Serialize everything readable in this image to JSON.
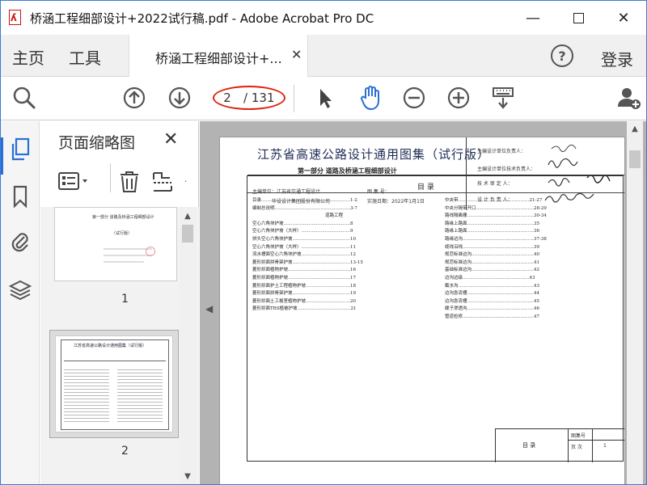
{
  "window": {
    "title": "桥涵工程细部设计+2022试行稿.pdf - Adobe Acrobat Pro DC",
    "min": "—",
    "max": "☐",
    "close": "✕"
  },
  "tabs": {
    "home": "主页",
    "tools": "工具",
    "doc_tab": "桥涵工程细部设计+...",
    "doc_close": "✕",
    "help": "?",
    "login": "登录"
  },
  "toolbar": {
    "page_current": "2",
    "page_total": "/ 131"
  },
  "thumbnails": {
    "title": "页面缩略图",
    "close": "✕",
    "pages": [
      {
        "label": "1",
        "heading": "第一部分   道路及桥涵工程细部设计",
        "sub": "（试行版）"
      },
      {
        "label": "2",
        "heading": "江苏省高速公路设计通用图集（试行版）"
      }
    ]
  },
  "document": {
    "title": "江苏省高速公路设计通用图集（试行版）",
    "subtitle": "第一部分   道路及桥涵工程细部设计",
    "org_line1": "主编单位：江苏省交通工程设计",
    "org_line2": "华设设计集团股份有限公司",
    "atlas_no": "图 集 号：",
    "date": "实施日期：2022年1月1日",
    "sig_labels": [
      "主编设计单位负责人：",
      "主编设计单位技术负责人：",
      "技 术 审 定 人：",
      "设 计 负 责 人："
    ],
    "toc_title": "目   录",
    "toc_left": [
      "目录……………………………………………………1-2",
      "编制总说明……………………………………………3-7",
      "道路工程",
      "空心六角块护坡………………………………………8",
      "空心六角块护坡（大样）……………………………9",
      "拼头空心六角块护坡…………………………………10",
      "空心六角块护坡（大样）……………………………11",
      "流水槽面空心六角块护坡……………………………12",
      "菱形拱面拼骨架护坡…………………………………13-15",
      "菱形拱面植物护坡……………………………………16",
      "菱形拱面植物护坡……………………………………17",
      "菱形拱面护土工程植物护坡…………………………18",
      "菱形拱面拼骨架护坡…………………………………19",
      "菱形拱面土工格室植物护坡…………………………20",
      "菱形拱面TBS植被护坡………………………………21"
    ],
    "toc_right": [
      "中央带…………………………………………21-27",
      "中央分隔带开口…………………………………28-29",
      "路线隔离栅………………………………………30-34",
      "路缘上路面………………………………………35",
      "路缘上路面………………………………………36",
      "路缘边沟…………………………………………37-38",
      "缆线沿线…………………………………………39",
      "规范标准边沟……………………………………40",
      "规范标准边沟……………………………………41",
      "基础标准边沟……………………………………42",
      "边沟边级………………………………………43",
      "截水沟……………………………………………43",
      "边沟急流槽………………………………………44",
      "边沟急流槽………………………………………45",
      "碟子渗透沟………………………………………46",
      "管道检修…………………………………………47"
    ],
    "footer_label": "目   录",
    "footer_no_label": "图集号",
    "footer_page_label": "页 次",
    "footer_page": "1"
  }
}
